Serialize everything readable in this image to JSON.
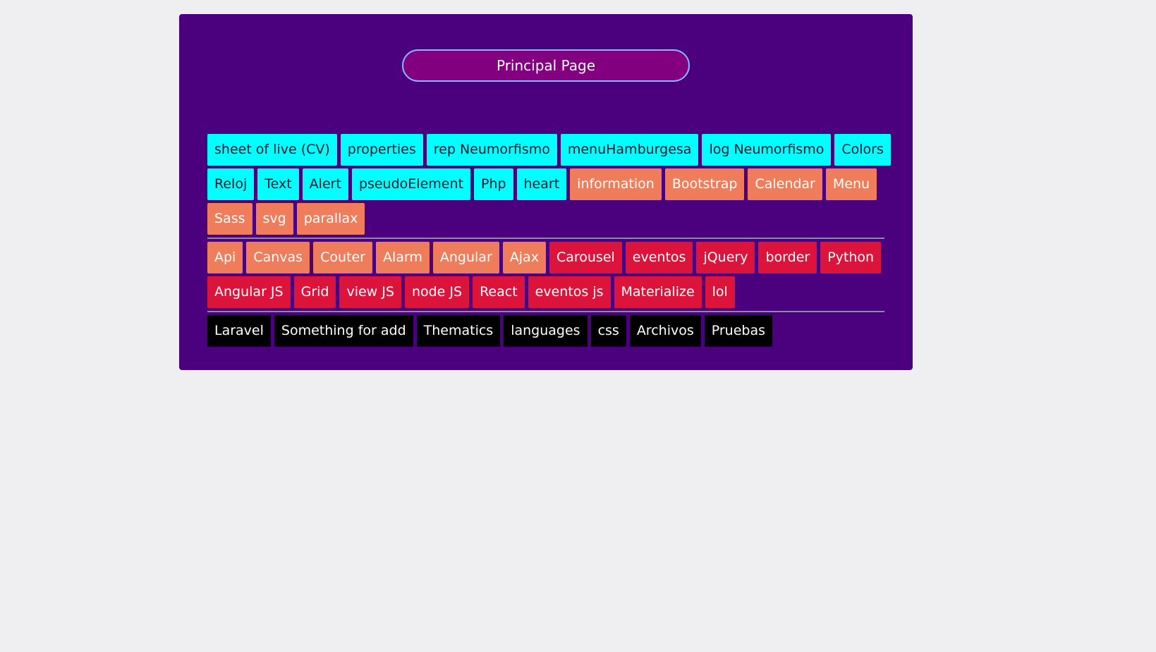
{
  "header": {
    "title": "Principal Page"
  },
  "colors": {
    "panel": "#4b007d",
    "pill": "#82007f",
    "cyan": "#00ffff",
    "salmon": "#ef7c5a",
    "crimson": "#dc143c",
    "black": "#000000"
  },
  "section1": {
    "rows": [
      [
        {
          "label": "sheet of live (CV)",
          "color": "cyan"
        },
        {
          "label": "properties",
          "color": "cyan"
        },
        {
          "label": "rep Neumorfismo",
          "color": "cyan"
        },
        {
          "label": "menuHamburgesa",
          "color": "cyan"
        },
        {
          "label": "log Neumorfismo",
          "color": "cyan"
        },
        {
          "label": "Colors",
          "color": "cyan"
        }
      ],
      [
        {
          "label": "Reloj",
          "color": "cyan"
        },
        {
          "label": "Text",
          "color": "cyan"
        },
        {
          "label": "Alert",
          "color": "cyan"
        },
        {
          "label": "pseudoElement",
          "color": "cyan"
        },
        {
          "label": "Php",
          "color": "cyan"
        },
        {
          "label": "heart",
          "color": "cyan"
        },
        {
          "label": "information",
          "color": "salmon"
        },
        {
          "label": "Bootstrap",
          "color": "salmon"
        },
        {
          "label": "Calendar",
          "color": "salmon"
        },
        {
          "label": "Menu",
          "color": "salmon"
        }
      ],
      [
        {
          "label": "Sass",
          "color": "salmon"
        },
        {
          "label": "svg",
          "color": "salmon"
        },
        {
          "label": "parallax",
          "color": "salmon"
        }
      ]
    ]
  },
  "section2": {
    "rows": [
      [
        {
          "label": "Api",
          "color": "salmon"
        },
        {
          "label": "Canvas",
          "color": "salmon"
        },
        {
          "label": "Couter",
          "color": "salmon"
        },
        {
          "label": "Alarm",
          "color": "salmon"
        },
        {
          "label": "Angular",
          "color": "salmon"
        },
        {
          "label": "Ajax",
          "color": "salmon"
        },
        {
          "label": "Carousel",
          "color": "crimson"
        },
        {
          "label": "eventos",
          "color": "crimson"
        },
        {
          "label": "jQuery",
          "color": "crimson"
        },
        {
          "label": "border",
          "color": "crimson"
        },
        {
          "label": "Python",
          "color": "crimson"
        }
      ],
      [
        {
          "label": "Angular JS",
          "color": "crimson"
        },
        {
          "label": "Grid",
          "color": "crimson"
        },
        {
          "label": "view JS",
          "color": "crimson"
        },
        {
          "label": "node JS",
          "color": "crimson"
        },
        {
          "label": "React",
          "color": "crimson"
        },
        {
          "label": "eventos js",
          "color": "crimson"
        },
        {
          "label": "Materialize",
          "color": "crimson"
        },
        {
          "label": "lol",
          "color": "crimson"
        }
      ]
    ]
  },
  "section3": {
    "rows": [
      [
        {
          "label": "Laravel",
          "color": "black"
        },
        {
          "label": "Something for add",
          "color": "black"
        },
        {
          "label": "Thematics",
          "color": "black"
        },
        {
          "label": "languages",
          "color": "black"
        },
        {
          "label": "css",
          "color": "black"
        },
        {
          "label": "Archivos",
          "color": "black"
        },
        {
          "label": "Pruebas",
          "color": "black"
        }
      ]
    ]
  }
}
